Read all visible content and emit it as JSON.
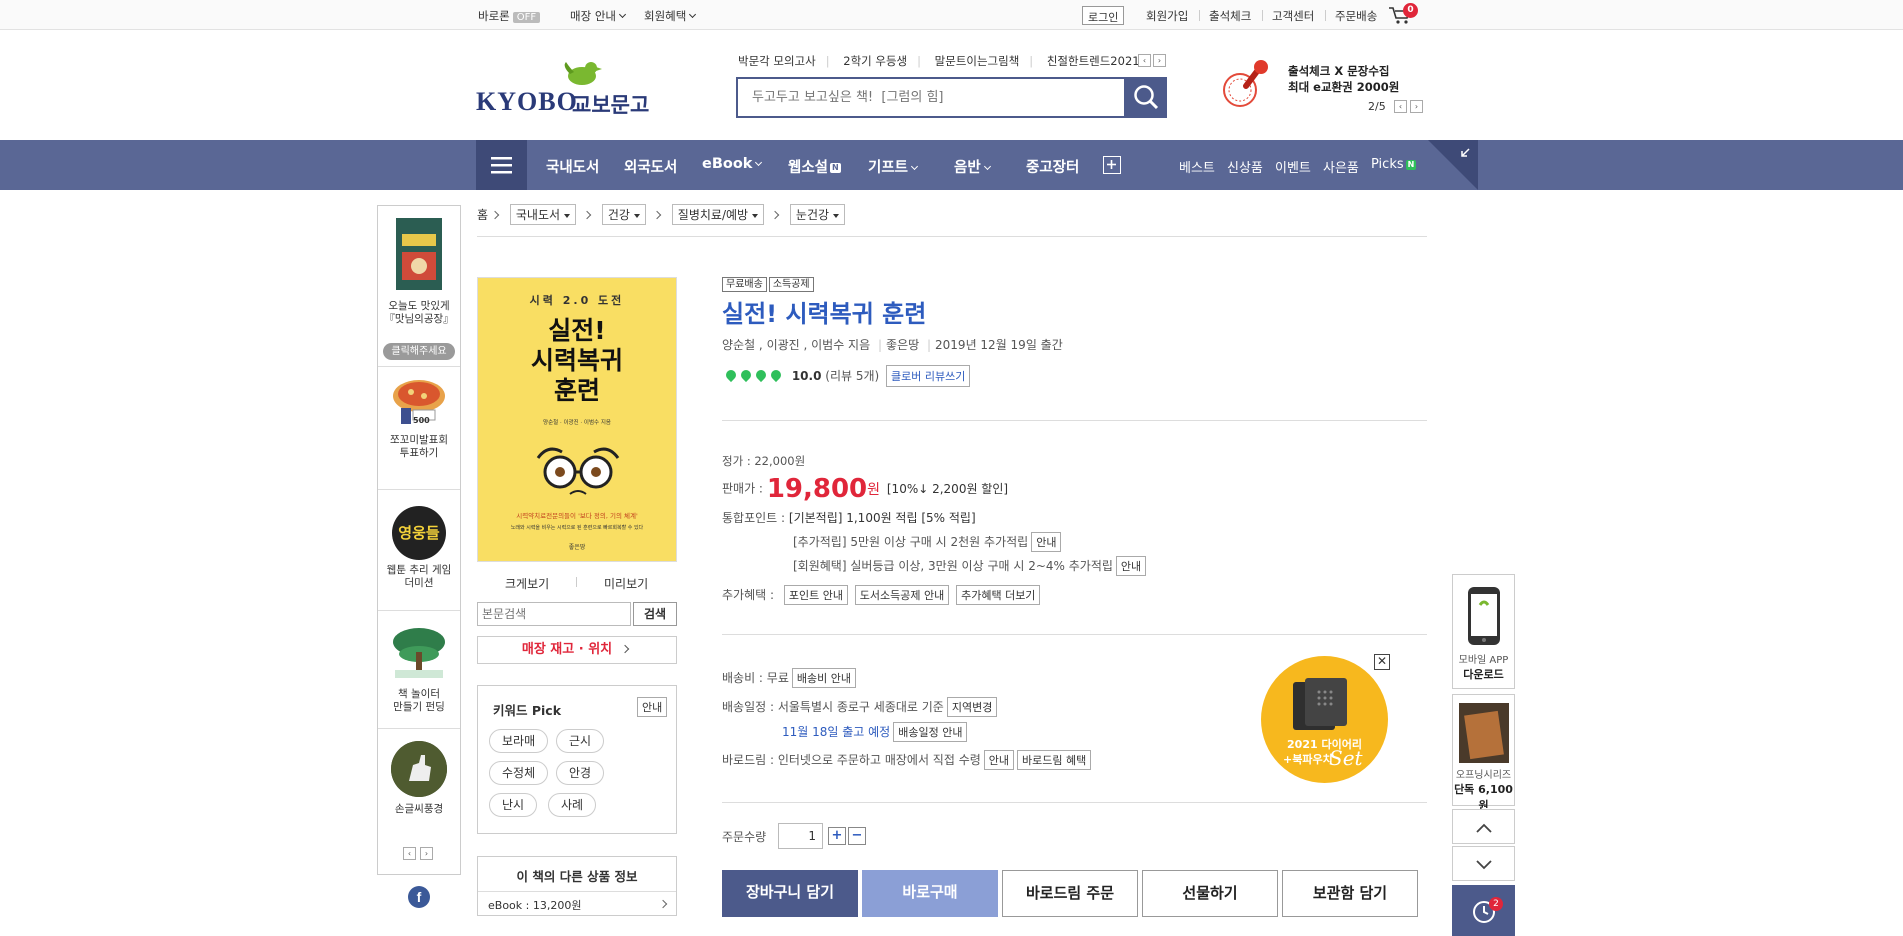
{
  "util": {
    "baroreturn": "바로론",
    "off": "OFF",
    "store_info": "매장 안내",
    "member_benefit": "회원혜택",
    "login": "로그인",
    "join": "회원가입",
    "attendance": "출석체크",
    "customer_center": "고객센터",
    "order_delivery": "주문배송",
    "cart_count": "0"
  },
  "header": {
    "logo_en": "KYOBO",
    "logo_ko": "교보문고",
    "hotwords": [
      "박문각 모의고사",
      "2학기 우등생",
      "말문트이는그림책",
      "친절한트렌드2021"
    ],
    "search_placeholder": "두고두고 보고싶은 책!  [그럼의 힘]",
    "promo_line1": "출석체크 X 문장수집",
    "promo_line2": "최대 e교환권 2000원",
    "promo_page": "2/5"
  },
  "gnb": {
    "items": [
      "국내도서",
      "외국도서",
      "eBook",
      "웹소설",
      "기프트",
      "음반",
      "중고장터"
    ],
    "new_badge": "N",
    "right": [
      "베스트",
      "신상품",
      "이벤트",
      "사은품",
      "Picks"
    ]
  },
  "left_sidebar": {
    "items": [
      {
        "label1": "오늘도 맛있게",
        "label2": "『맛님의공장』"
      },
      {
        "label1": "쪼꼬미발표회",
        "label2": "투표하기"
      },
      {
        "label1": "웹툰 추리 게임",
        "label2": "더미션"
      },
      {
        "label1": "책 놀이터",
        "label2": "만들기 펀딩"
      },
      {
        "label1": "손글씨풍경",
        "label2": ""
      }
    ],
    "click_label": "클릭해주세요",
    "pizza_tag": "500",
    "webtoon_text": "영웅들"
  },
  "breadcrumb": {
    "home": "홈",
    "levels": [
      "국내도서",
      "건강",
      "질병치료/예방",
      "눈건강"
    ]
  },
  "book": {
    "cover_top": "시력 2.0 도전",
    "cover_title1": "실전!",
    "cover_title2": "시력복귀",
    "cover_title3": "훈련",
    "cover_authors": "양순철 · 이광진 · 이범수 지음",
    "cover_subtitle": "시력약치료전문의들이 '보다 정의, 기의 체계'",
    "cover_bottom": "노래와 시력을 비우는 시력으로 된 훈련으로 빠르회복할 수 있다",
    "cover_publisher": "좋은땅",
    "zoom": "크게보기",
    "preview": "미리보기",
    "content_search_placeholder": "본문검색",
    "content_search_btn": "검색",
    "stock_btn": "매장 재고 · 위치"
  },
  "keyword_pick": {
    "title": "키워드 Pick",
    "guide": "안내",
    "chips": [
      "보라매",
      "근시",
      "수정체",
      "안경",
      "난시",
      "사례"
    ]
  },
  "other_products": {
    "title": "이 책의 다른 상품 정보",
    "ebook": "eBook : 13,200원"
  },
  "product": {
    "tags": [
      "무료배송",
      "소득공제"
    ],
    "title": "실전! 시력복귀 훈련",
    "authors": "양순철 , 이광진 , 이범수 지음",
    "publisher": "좋은땅",
    "pub_date": "2019년 12월 19일 출간",
    "rating": "10.0",
    "reviews": "(리뷰 5개)",
    "review_btn": "클로버 리뷰쓰기",
    "list_price": "정가 : 22,000원",
    "sale_label": "판매가 :",
    "sale_price": "19,800",
    "won": "원",
    "discount": "[10%↓ 2,200원 할인]",
    "point_label": "통합포인트 :",
    "point_basic": "[기본적립] 1,100원 적립 [5% 적립]",
    "point_extra": "[추가적립] 5만원 이상 구매 시 2천원 추가적립",
    "point_member": "[회원혜택] 실버등급 이상, 3만원 이상 구매 시 2~4% 추가적립",
    "guide": "안내",
    "extra_label": "추가혜택 :",
    "extra_btns": [
      "포인트 안내",
      "도서소득공제 안내",
      "추가혜택 더보기"
    ],
    "ship_fee": "배송비 : 무료",
    "ship_fee_btn": "배송비 안내",
    "ship_schedule": "배송일정 : 서울특별시 종로구 세종대로 기준",
    "region_btn": "지역변경",
    "ship_date": "11월 18일 출고 예정",
    "ship_schedule_btn": "배송일정 안내",
    "barodrim": "바로드림 : 인터넷으로 주문하고 매장에서 직접 수령",
    "barodrim_guide": "안내",
    "barodrim_benefit": "바로드림 혜택",
    "qty_label": "주문수량",
    "qty": "1",
    "buttons": [
      "장바구니 담기",
      "바로구매",
      "바로드림 주문",
      "선물하기",
      "보관함 담기"
    ]
  },
  "promo_circle": {
    "line1": "2021 다이어리",
    "line2": "+북파우치",
    "line3": "Set"
  },
  "right_sidebar": {
    "app_label1": "모바일 APP",
    "app_label2": "다운로드",
    "openings_label1": "오프닝시리즈",
    "openings_label2": "단독 6,100원",
    "recent_count": "2"
  }
}
